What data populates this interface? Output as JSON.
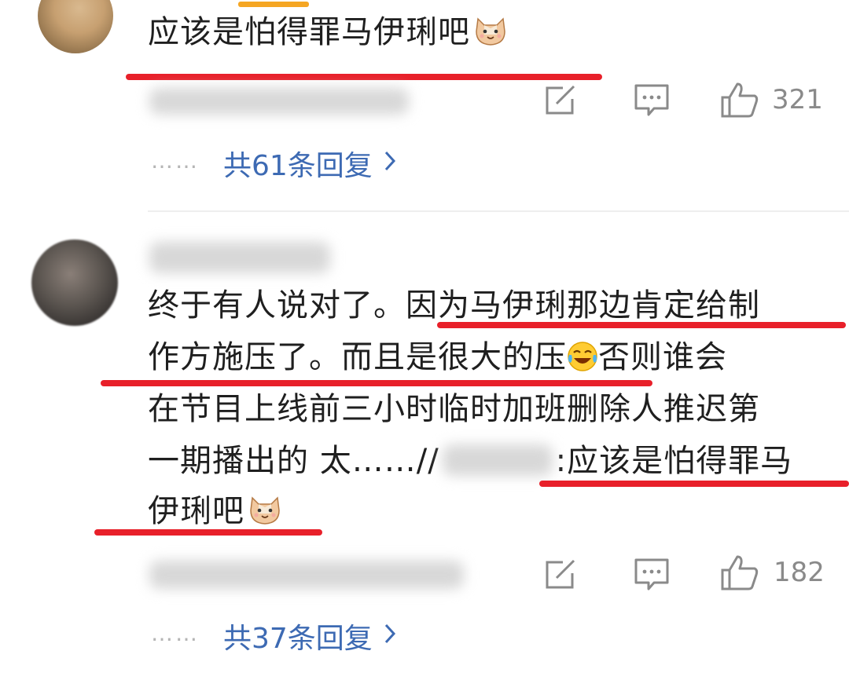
{
  "comment1": {
    "text": "应该是怕得罪马伊琍吧",
    "meta_blurred": "",
    "likes": "321",
    "replies_label": "共61条回复",
    "dots": "……"
  },
  "comment2": {
    "line1a": "终于有人说对了。",
    "line1b": "因为马伊琍那边肯定给制",
    "line2": "作方施压了。而且是很大的压",
    "line2b": "否则谁会",
    "line3": "在节目上线前三小时临时加班删除人推迟第",
    "line4a": "一期播出的 太……//",
    "line4b": ":应该是怕得罪马",
    "line5": "伊琍吧",
    "likes": "182",
    "replies_label": "共37条回复",
    "dots": "……"
  },
  "icons": {
    "share": "share-edit-icon",
    "comment": "comment-icon",
    "like": "thumbs-up-icon",
    "chevron": "chevron-right-icon"
  },
  "colors": {
    "underline": "#e8202a",
    "link": "#3d6ab3",
    "muted": "#8a8a8a"
  }
}
